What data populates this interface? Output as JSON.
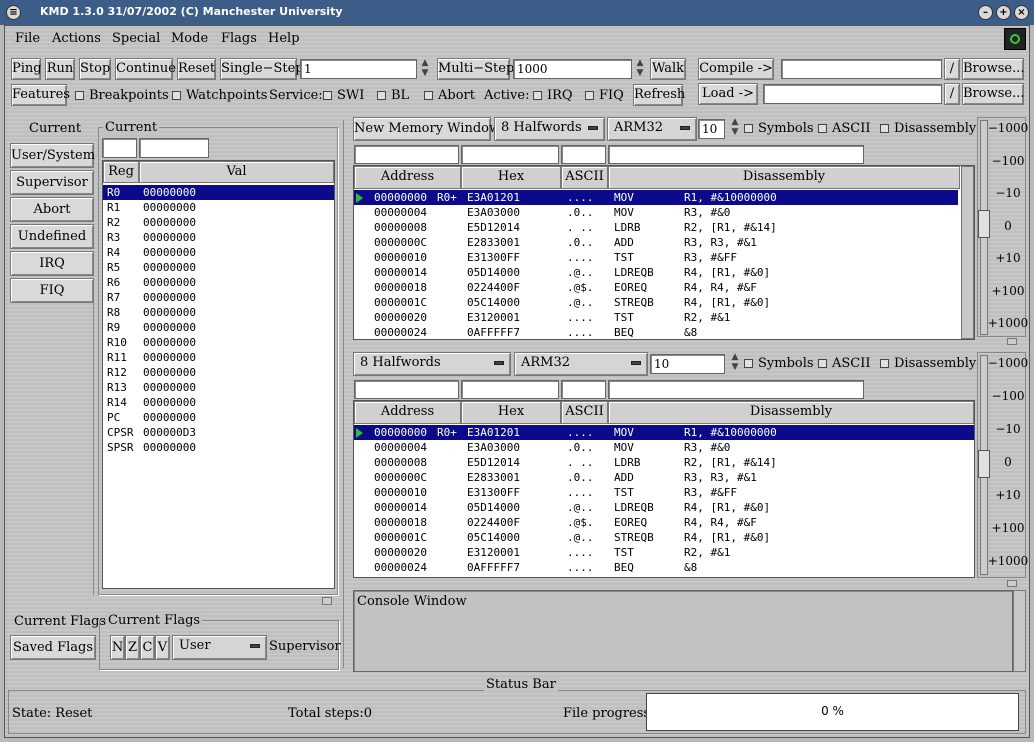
{
  "window": {
    "title": "KMD 1.3.0 31/07/2002 (C) Manchester University"
  },
  "menu": [
    "File",
    "Actions",
    "Special",
    "Mode",
    "Flags",
    "Help"
  ],
  "toolbar": {
    "ping": "Ping",
    "run": "Run",
    "stop": "Stop",
    "continue": "Continue",
    "reset": "Reset",
    "single_step": "Single−Step",
    "single_step_value": "1",
    "multi_step": "Multi−Step",
    "multi_step_value": "1000",
    "walk": "Walk",
    "compile": "Compile ->",
    "load": "Load ->",
    "slash": "/",
    "browse": "Browse...",
    "features": "Features",
    "breakpoints": "Breakpoints",
    "watchpoints": "Watchpoints",
    "service_label": "Service:",
    "swi": "SWI",
    "bl": "BL",
    "abort": "Abort",
    "active_label": "Active:",
    "irq": "IRQ",
    "fiq": "FIQ",
    "refresh": "Refresh"
  },
  "modes": {
    "current_label": "Current",
    "items": [
      "User/System",
      "Supervisor",
      "Abort",
      "Undefined",
      "IRQ",
      "FIQ"
    ]
  },
  "registers": {
    "group_label": "Current",
    "col_reg": "Reg",
    "col_val": "Val",
    "rows": [
      [
        "R0",
        "00000000"
      ],
      [
        "R1",
        "00000000"
      ],
      [
        "R2",
        "00000000"
      ],
      [
        "R3",
        "00000000"
      ],
      [
        "R4",
        "00000000"
      ],
      [
        "R5",
        "00000000"
      ],
      [
        "R6",
        "00000000"
      ],
      [
        "R7",
        "00000000"
      ],
      [
        "R8",
        "00000000"
      ],
      [
        "R9",
        "00000000"
      ],
      [
        "R10",
        "00000000"
      ],
      [
        "R11",
        "00000000"
      ],
      [
        "R12",
        "00000000"
      ],
      [
        "R13",
        "00000000"
      ],
      [
        "R14",
        "00000000"
      ],
      [
        "PC",
        "00000000"
      ],
      [
        "CPSR",
        "000000D3"
      ],
      [
        "SPSR",
        "00000000"
      ]
    ]
  },
  "flags": {
    "current_flags": "Current Flags",
    "saved_flags": "Saved Flags",
    "group_label": "Current Flags",
    "n": "N",
    "z": "Z",
    "c": "C",
    "v": "V",
    "mode_value": "User",
    "supervisor": "Supervisor"
  },
  "memory": {
    "new_window": "New Memory Window",
    "halfwords": "8 Halfwords",
    "arch": "ARM32",
    "count": "10",
    "symbols": "Symbols",
    "ascii": "ASCII",
    "disassembly": "Disassembly",
    "col_address": "Address",
    "col_hex": "Hex",
    "col_ascii": "ASCII",
    "col_disassembly": "Disassembly",
    "rows": [
      {
        "addr": "00000000",
        "tag": "R0+",
        "hex": "E3A01201",
        "ascii": "....",
        "op": "MOV",
        "args": "R1, #&10000000"
      },
      {
        "addr": "00000004",
        "tag": "",
        "hex": "E3A03000",
        "ascii": ".0..",
        "op": "MOV",
        "args": "R3, #&0"
      },
      {
        "addr": "00000008",
        "tag": "",
        "hex": "E5D12014",
        "ascii": ". ..",
        "op": "LDRB",
        "args": "R2, [R1, #&14]"
      },
      {
        "addr": "0000000C",
        "tag": "",
        "hex": "E2833001",
        "ascii": ".0..",
        "op": "ADD",
        "args": "R3, R3, #&1"
      },
      {
        "addr": "00000010",
        "tag": "",
        "hex": "E31300FF",
        "ascii": "....",
        "op": "TST",
        "args": "R3, #&FF"
      },
      {
        "addr": "00000014",
        "tag": "",
        "hex": "05D14000",
        "ascii": ".@..",
        "op": "LDREQB",
        "args": "R4, [R1, #&0]"
      },
      {
        "addr": "00000018",
        "tag": "",
        "hex": "0224400F",
        "ascii": ".@$.",
        "op": "EOREQ",
        "args": "R4, R4, #&F"
      },
      {
        "addr": "0000001C",
        "tag": "",
        "hex": "05C14000",
        "ascii": ".@..",
        "op": "STREQB",
        "args": "R4, [R1, #&0]"
      },
      {
        "addr": "00000020",
        "tag": "",
        "hex": "E3120001",
        "ascii": "....",
        "op": "TST",
        "args": "R2, #&1"
      },
      {
        "addr": "00000024",
        "tag": "",
        "hex": "0AFFFFF7",
        "ascii": "....",
        "op": "BEQ",
        "args": "&8"
      }
    ],
    "scale": [
      "−1000",
      "−100",
      "−10",
      "0",
      "+10",
      "+100",
      "+1000"
    ]
  },
  "console": {
    "title": "Console Window"
  },
  "status": {
    "title": "Status Bar",
    "state": "State: Reset",
    "total_steps": "Total steps:0",
    "file_progress_label": "File progress:",
    "progress_text": "0 %",
    "progress": 0
  }
}
